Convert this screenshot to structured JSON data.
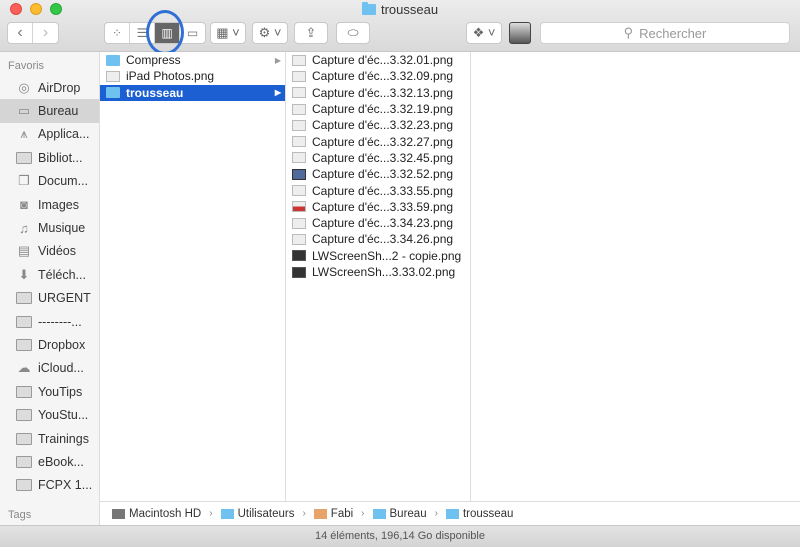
{
  "window": {
    "title": "trousseau"
  },
  "toolbar": {
    "back": "‹",
    "forward": "›",
    "view_modes": [
      "icon-view",
      "list-view",
      "column-view",
      "coverflow-view"
    ],
    "active_view": "column-view",
    "search_placeholder": "Rechercher"
  },
  "sidebar": {
    "favorites_header": "Favoris",
    "items": [
      {
        "label": "AirDrop",
        "icon": "airdrop-icon"
      },
      {
        "label": "Bureau",
        "icon": "desktop-icon",
        "selected": true
      },
      {
        "label": "Applica...",
        "icon": "applications-icon"
      },
      {
        "label": "Bibliot...",
        "icon": "folder-icon"
      },
      {
        "label": "Docum...",
        "icon": "documents-icon"
      },
      {
        "label": "Images",
        "icon": "camera-icon"
      },
      {
        "label": "Musique",
        "icon": "music-icon"
      },
      {
        "label": "Vidéos",
        "icon": "film-icon"
      },
      {
        "label": "Téléch...",
        "icon": "download-icon"
      },
      {
        "label": "URGENT",
        "icon": "folder-icon"
      },
      {
        "label": "--------...",
        "icon": "folder-icon"
      },
      {
        "label": "Dropbox",
        "icon": "folder-icon"
      },
      {
        "label": "iCloud...",
        "icon": "cloud-icon"
      },
      {
        "label": "YouTips",
        "icon": "folder-icon"
      },
      {
        "label": "YouStu...",
        "icon": "folder-icon"
      },
      {
        "label": "Trainings",
        "icon": "folder-icon"
      },
      {
        "label": "eBook...",
        "icon": "folder-icon"
      },
      {
        "label": "FCPX 1...",
        "icon": "folder-icon"
      }
    ],
    "tags_header": "Tags"
  },
  "column1": [
    {
      "name": "Compress",
      "type": "folder",
      "has_children": true
    },
    {
      "name": "iPad Photos.png",
      "type": "png"
    },
    {
      "name": "trousseau",
      "type": "folder",
      "has_children": true,
      "selected": true
    }
  ],
  "column2": [
    {
      "name": "Capture d'éc...3.32.01.png",
      "type": "png"
    },
    {
      "name": "Capture d'éc...3.32.09.png",
      "type": "png"
    },
    {
      "name": "Capture d'éc...3.32.13.png",
      "type": "png"
    },
    {
      "name": "Capture d'éc...3.32.19.png",
      "type": "png"
    },
    {
      "name": "Capture d'éc...3.32.23.png",
      "type": "png"
    },
    {
      "name": "Capture d'éc...3.32.27.png",
      "type": "png"
    },
    {
      "name": "Capture d'éc...3.32.45.png",
      "type": "png"
    },
    {
      "name": "Capture d'éc...3.32.52.png",
      "type": "blueimg"
    },
    {
      "name": "Capture d'éc...3.33.55.png",
      "type": "png"
    },
    {
      "name": "Capture d'éc...3.33.59.png",
      "type": "red"
    },
    {
      "name": "Capture d'éc...3.34.23.png",
      "type": "png"
    },
    {
      "name": "Capture d'éc...3.34.26.png",
      "type": "png"
    },
    {
      "name": "LWScreenSh...2 - copie.png",
      "type": "dark"
    },
    {
      "name": "LWScreenSh...3.33.02.png",
      "type": "dark"
    }
  ],
  "pathbar": [
    {
      "label": "Macintosh HD",
      "icon": "disk-icon"
    },
    {
      "label": "Utilisateurs",
      "icon": "folder-icon"
    },
    {
      "label": "Fabi",
      "icon": "home-icon"
    },
    {
      "label": "Bureau",
      "icon": "folder-icon"
    },
    {
      "label": "trousseau",
      "icon": "folder-icon"
    }
  ],
  "status": "14 éléments, 196,14 Go disponible"
}
